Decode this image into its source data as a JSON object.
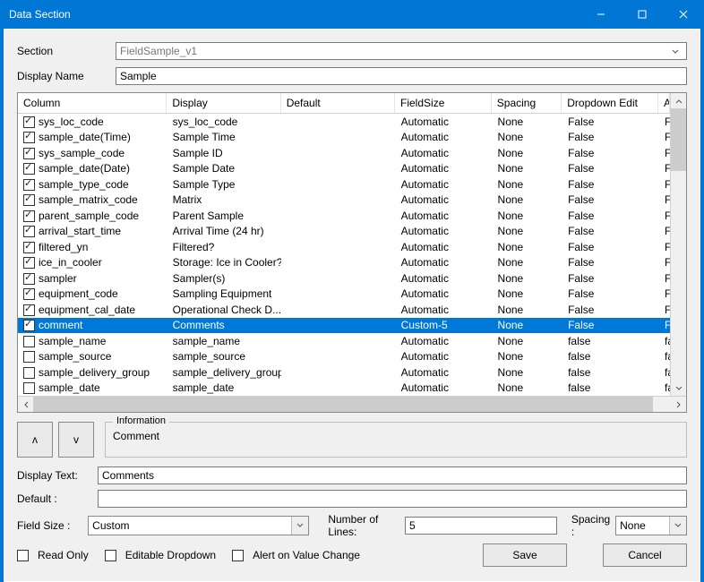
{
  "title": "Data Section",
  "labels": {
    "section": "Section",
    "displayName": "Display Name",
    "information": "Information",
    "displayText": "Display Text:",
    "default": "Default  :",
    "fieldSize": "Field Size :",
    "numLines": "Number of Lines:",
    "spacing": "Spacing :",
    "readOnly": "Read Only",
    "editableDropdown": "Editable Dropdown",
    "alertChange": "Alert on Value Change",
    "save": "Save",
    "cancel": "Cancel"
  },
  "section": {
    "value": "FieldSample_v1"
  },
  "displayName": "Sample",
  "columns": [
    "Column",
    "Display",
    "Default",
    "FieldSize",
    "Spacing",
    "Dropdown Edit",
    "Alert"
  ],
  "rows": [
    {
      "checked": true,
      "col": "sys_loc_code",
      "display": "sys_loc_code",
      "default": "",
      "fieldSize": "Automatic",
      "spacing": "None",
      "dd": "False",
      "alert": "False"
    },
    {
      "checked": true,
      "col": "sample_date(Time)",
      "display": "Sample Time",
      "default": "",
      "fieldSize": "Automatic",
      "spacing": "None",
      "dd": "False",
      "alert": "False"
    },
    {
      "checked": true,
      "col": "sys_sample_code",
      "display": "Sample ID",
      "default": "",
      "fieldSize": "Automatic",
      "spacing": "None",
      "dd": "False",
      "alert": "False"
    },
    {
      "checked": true,
      "col": "sample_date(Date)",
      "display": "Sample Date",
      "default": "",
      "fieldSize": "Automatic",
      "spacing": "None",
      "dd": "False",
      "alert": "False"
    },
    {
      "checked": true,
      "col": "sample_type_code",
      "display": "Sample Type",
      "default": "",
      "fieldSize": "Automatic",
      "spacing": "None",
      "dd": "False",
      "alert": "False"
    },
    {
      "checked": true,
      "col": "sample_matrix_code",
      "display": "Matrix",
      "default": "",
      "fieldSize": "Automatic",
      "spacing": "None",
      "dd": "False",
      "alert": "False"
    },
    {
      "checked": true,
      "col": "parent_sample_code",
      "display": "Parent Sample",
      "default": "",
      "fieldSize": "Automatic",
      "spacing": "None",
      "dd": "False",
      "alert": "False"
    },
    {
      "checked": true,
      "col": "arrival_start_time",
      "display": "Arrival Time (24 hr)",
      "default": "",
      "fieldSize": "Automatic",
      "spacing": "None",
      "dd": "False",
      "alert": "False"
    },
    {
      "checked": true,
      "col": "filtered_yn",
      "display": "Filtered?",
      "default": "",
      "fieldSize": "Automatic",
      "spacing": "None",
      "dd": "False",
      "alert": "False"
    },
    {
      "checked": true,
      "col": "ice_in_cooler",
      "display": "Storage: Ice in Cooler?",
      "default": "",
      "fieldSize": "Automatic",
      "spacing": "None",
      "dd": "False",
      "alert": "False"
    },
    {
      "checked": true,
      "col": "sampler",
      "display": "Sampler(s)",
      "default": "",
      "fieldSize": "Automatic",
      "spacing": "None",
      "dd": "False",
      "alert": "False"
    },
    {
      "checked": true,
      "col": "equipment_code",
      "display": "Sampling Equipment",
      "default": "",
      "fieldSize": "Automatic",
      "spacing": "None",
      "dd": "False",
      "alert": "False"
    },
    {
      "checked": true,
      "col": "equipment_cal_date",
      "display": "Operational Check D...",
      "default": "",
      "fieldSize": "Automatic",
      "spacing": "None",
      "dd": "False",
      "alert": "False"
    },
    {
      "checked": true,
      "col": "comment",
      "display": "Comments",
      "default": "",
      "fieldSize": "Custom-5",
      "spacing": "None",
      "dd": "False",
      "alert": "False",
      "selected": true
    },
    {
      "checked": false,
      "col": "sample_name",
      "display": "sample_name",
      "default": "",
      "fieldSize": "Automatic",
      "spacing": "None",
      "dd": "false",
      "alert": "false"
    },
    {
      "checked": false,
      "col": "sample_source",
      "display": "sample_source",
      "default": "",
      "fieldSize": "Automatic",
      "spacing": "None",
      "dd": "false",
      "alert": "false"
    },
    {
      "checked": false,
      "col": "sample_delivery_group",
      "display": "sample_delivery_group",
      "default": "",
      "fieldSize": "Automatic",
      "spacing": "None",
      "dd": "false",
      "alert": "false"
    },
    {
      "checked": false,
      "col": "sample_date",
      "display": "sample_date",
      "default": "",
      "fieldSize": "Automatic",
      "spacing": "None",
      "dd": "false",
      "alert": "false"
    }
  ],
  "information": "Comment",
  "form": {
    "displayText": "Comments",
    "default": "",
    "fieldSize": "Custom",
    "numLines": "5",
    "spacing": "None",
    "readOnly": false,
    "editableDropdown": false,
    "alertChange": false
  }
}
